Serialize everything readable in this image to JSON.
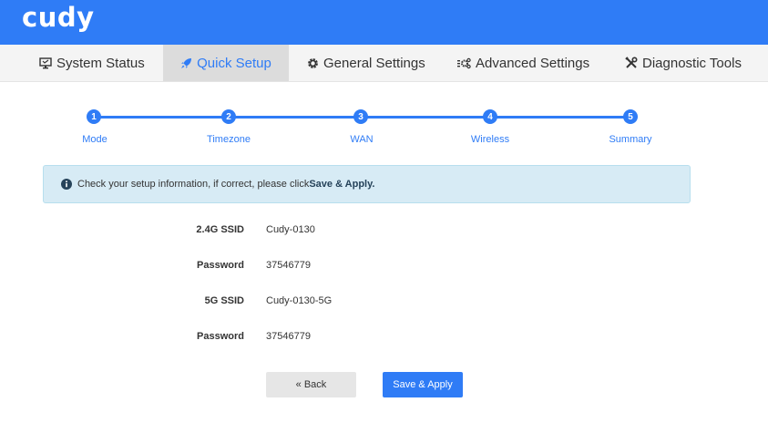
{
  "brand": {
    "logo_text": "cudy",
    "color": "#2f7cf6"
  },
  "nav": {
    "items": [
      {
        "label": "System Status",
        "icon": "monitor-icon"
      },
      {
        "label": "Quick Setup",
        "icon": "rocket-icon",
        "active": true
      },
      {
        "label": "General Settings",
        "icon": "gear-icon"
      },
      {
        "label": "Advanced Settings",
        "icon": "gears-icon"
      },
      {
        "label": "Diagnostic Tools",
        "icon": "tools-icon"
      }
    ]
  },
  "wizard": {
    "steps": [
      {
        "number": "1",
        "label": "Mode"
      },
      {
        "number": "2",
        "label": "Timezone"
      },
      {
        "number": "3",
        "label": "WAN"
      },
      {
        "number": "4",
        "label": "Wireless"
      },
      {
        "number": "5",
        "label": "Summary"
      }
    ]
  },
  "alert": {
    "icon": "info-circle-icon",
    "text": "Check your setup information, if correct, please click ",
    "emphasis": "Save & Apply."
  },
  "summary": {
    "rows": [
      {
        "label": "2.4G SSID",
        "value": "Cudy-0130"
      },
      {
        "label": "Password",
        "value": "37546779"
      },
      {
        "label": "5G SSID",
        "value": "Cudy-0130-5G"
      },
      {
        "label": "Password",
        "value": "37546779"
      }
    ]
  },
  "buttons": {
    "back_label": "« Back",
    "save_label": "Save & Apply"
  }
}
